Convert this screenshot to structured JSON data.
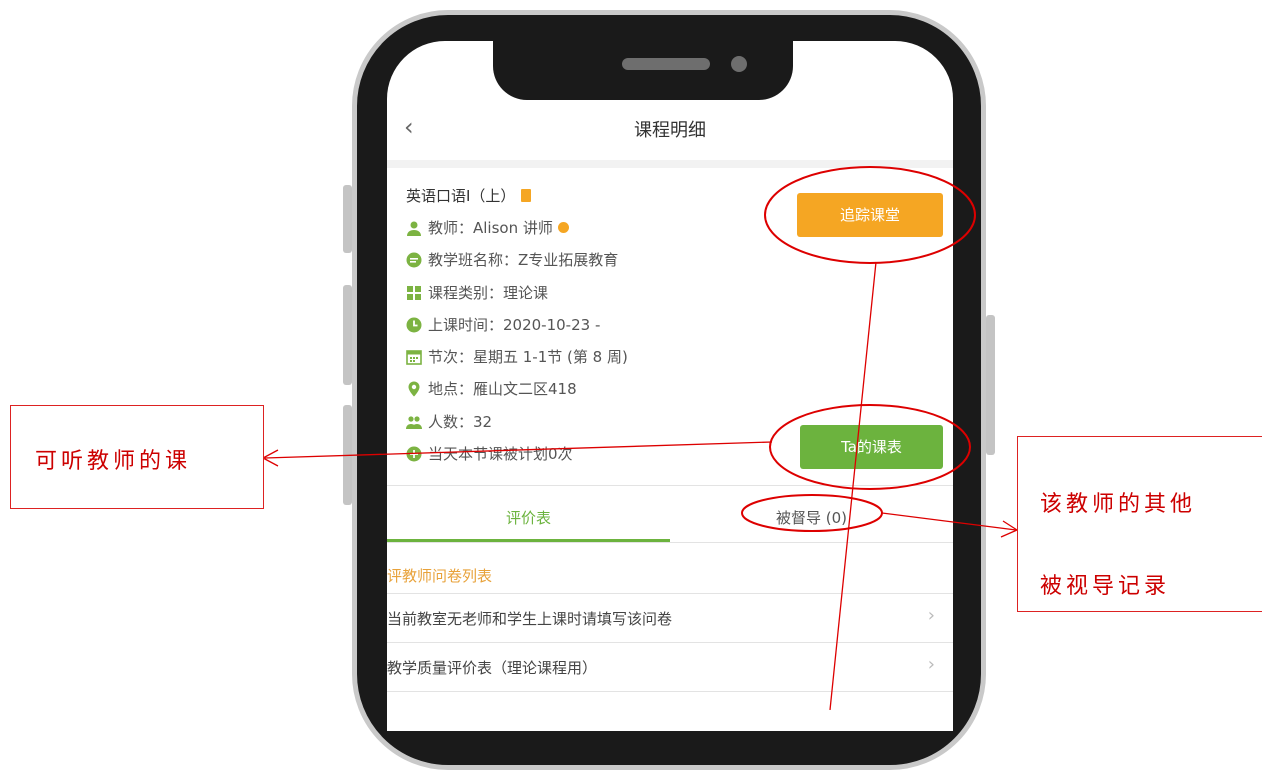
{
  "nav": {
    "title": "课程明细",
    "back_icon": "chevron-left-icon"
  },
  "course": {
    "name": "英语口语I（上）",
    "badge_icon": "book-icon"
  },
  "details": [
    {
      "icon": "person-icon",
      "color": "#7cb342",
      "text": "教师：Alison 讲师"
    },
    {
      "icon": "chat-bubble-icon",
      "color": "#7cb342",
      "text": "教学班名称：Z专业拓展教育"
    },
    {
      "icon": "grid-icon",
      "color": "#7cb342",
      "text": "课程类别：理论课"
    },
    {
      "icon": "clock-icon",
      "color": "#7cb342",
      "text": "上课时间：2020-10-23 -"
    },
    {
      "icon": "calendar-icon",
      "color": "#7cb342",
      "text": "节次：星期五 1-1节 (第 8 周)"
    },
    {
      "icon": "location-pin-icon",
      "color": "#7cb342",
      "text": "地点：雁山文二区418"
    },
    {
      "icon": "people-icon",
      "color": "#7cb342",
      "text": "人数：32"
    },
    {
      "icon": "plus-circle-icon",
      "color": "#7cb342",
      "text": "当天本节课被计划0次"
    }
  ],
  "buttons": {
    "track": {
      "label": "追踪课堂",
      "color": "#f5a623"
    },
    "schedule": {
      "label": "Ta的课表",
      "color": "#6cb33e"
    }
  },
  "tabs": [
    {
      "label": "评价表",
      "active": true
    },
    {
      "label": "被督导 (0)",
      "active": false
    }
  ],
  "section_title": "评教师问卷列表",
  "list": [
    {
      "label": "当前教室无老师和学生上课时请填写该问卷"
    },
    {
      "label": "教学质量评价表（理论课程用）"
    }
  ],
  "callouts": {
    "left": "可听教师的课",
    "right_line1": "该教师的其他",
    "right_line2": "被视导记录"
  },
  "colors": {
    "accent_green": "#6cb33e",
    "accent_orange": "#f5a623",
    "annotation_red": "#dd0000"
  }
}
